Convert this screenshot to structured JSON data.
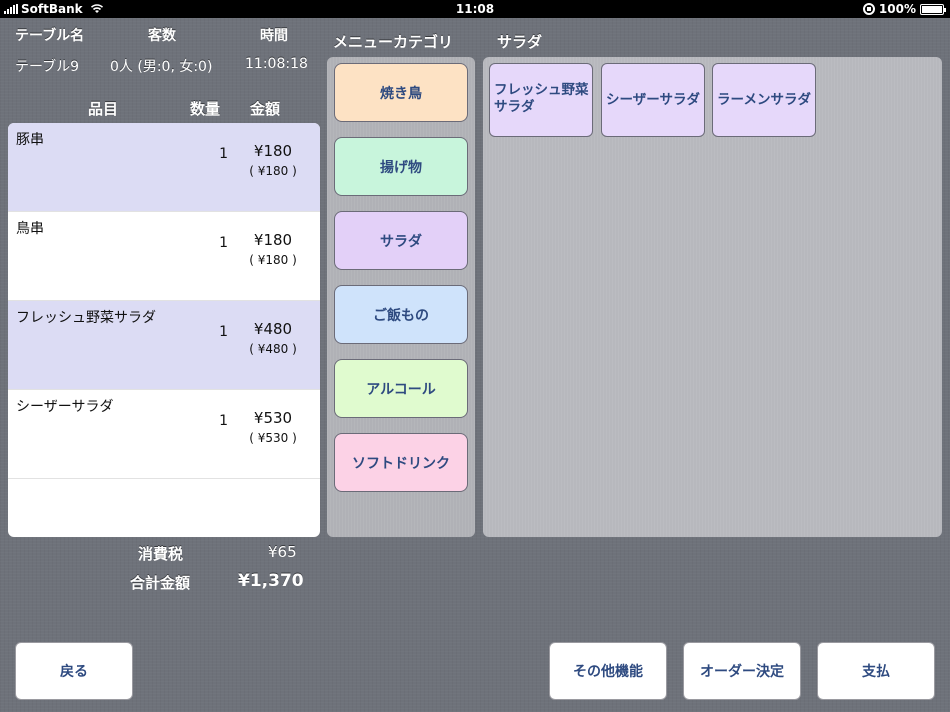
{
  "status_bar": {
    "carrier": "SoftBank",
    "time": "11:08",
    "battery": "100%"
  },
  "header": {
    "table_label": "テーブル名",
    "guests_label": "客数",
    "time_label": "時間",
    "table_value": "テーブル9",
    "guests_value": "0人 (男:0, 女:0)",
    "time_value": "11:08:18"
  },
  "order_columns": {
    "item": "品目",
    "qty": "数量",
    "amount": "金額"
  },
  "orders": [
    {
      "name": "豚串",
      "qty": "1",
      "price": "¥180",
      "sub": "( ¥180 )"
    },
    {
      "name": "鳥串",
      "qty": "1",
      "price": "¥180",
      "sub": "( ¥180 )"
    },
    {
      "name": "フレッシュ野菜サラダ",
      "qty": "1",
      "price": "¥480",
      "sub": "( ¥480 )"
    },
    {
      "name": "シーザーサラダ",
      "qty": "1",
      "price": "¥530",
      "sub": "( ¥530 )"
    }
  ],
  "totals": {
    "tax_label": "消費税",
    "tax_value": "¥65",
    "total_label": "合計金額",
    "total_value": "¥1,370"
  },
  "category_panel": {
    "title": "メニューカテゴリ",
    "categories": [
      {
        "label": "焼き鳥",
        "color": "#fde2c4"
      },
      {
        "label": "揚げ物",
        "color": "#c8f5dc"
      },
      {
        "label": "サラダ",
        "color": "#e3d0f8"
      },
      {
        "label": "ご飯もの",
        "color": "#cfe3fb"
      },
      {
        "label": "アルコール",
        "color": "#e0fbcf"
      },
      {
        "label": "ソフトドリンク",
        "color": "#fcd2e6"
      }
    ]
  },
  "item_panel": {
    "title": "サラダ",
    "items": [
      {
        "label": "フレッシュ野菜サラダ"
      },
      {
        "label": "シーザーサラダ"
      },
      {
        "label": "ラーメンサラダ"
      }
    ]
  },
  "buttons": {
    "back": "戻る",
    "other": "その他機能",
    "confirm": "オーダー決定",
    "pay": "支払"
  }
}
